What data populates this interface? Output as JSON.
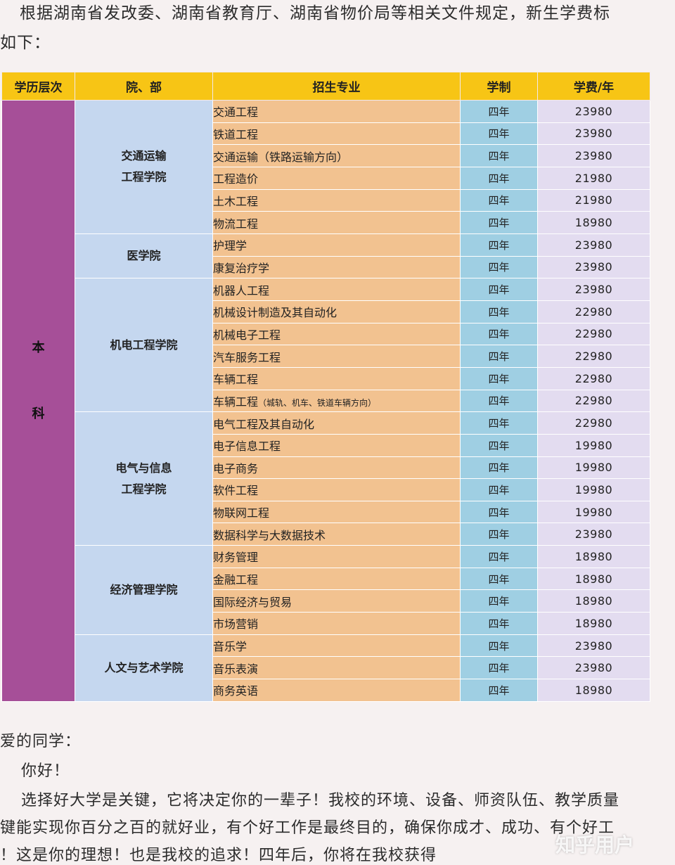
{
  "intro": {
    "line1": "根据湖南省发改委、湖南省教育厅、湖南省物价局等相关文件规定，新生学费标",
    "line2": "如下："
  },
  "table": {
    "headers": [
      "学历层次",
      "院、部",
      "招生专业",
      "学制",
      "学费/年"
    ],
    "level_chars": [
      "本",
      "科"
    ],
    "departments": [
      {
        "name_lines": [
          "交通运输",
          "工程学院"
        ],
        "majors": [
          {
            "name": "交通工程",
            "years": "四年",
            "fee": "23980"
          },
          {
            "name": "铁道工程",
            "years": "四年",
            "fee": "23980"
          },
          {
            "name": "交通运输（铁路运输方向）",
            "years": "四年",
            "fee": "23980"
          },
          {
            "name": "工程造价",
            "years": "四年",
            "fee": "21980"
          },
          {
            "name": "土木工程",
            "years": "四年",
            "fee": "21980"
          },
          {
            "name": "物流工程",
            "years": "四年",
            "fee": "18980"
          }
        ]
      },
      {
        "name_lines": [
          "医学院"
        ],
        "majors": [
          {
            "name": "护理学",
            "years": "四年",
            "fee": "23980"
          },
          {
            "name": "康复治疗学",
            "years": "四年",
            "fee": "23980"
          }
        ]
      },
      {
        "name_lines": [
          "机电工程学院"
        ],
        "majors": [
          {
            "name": "机器人工程",
            "years": "四年",
            "fee": "23980"
          },
          {
            "name": "机械设计制造及其自动化",
            "years": "四年",
            "fee": "22980"
          },
          {
            "name": "机械电子工程",
            "years": "四年",
            "fee": "22980"
          },
          {
            "name": "汽车服务工程",
            "years": "四年",
            "fee": "22980"
          },
          {
            "name": "车辆工程",
            "years": "四年",
            "fee": "22980"
          },
          {
            "name": "车辆工程",
            "note": "（城轨、机车、铁道车辆方向）",
            "years": "四年",
            "fee": "22980"
          }
        ]
      },
      {
        "name_lines": [
          "电气与信息",
          "工程学院"
        ],
        "majors": [
          {
            "name": "电气工程及其自动化",
            "years": "四年",
            "fee": "22980"
          },
          {
            "name": "电子信息工程",
            "years": "四年",
            "fee": "19980"
          },
          {
            "name": "电子商务",
            "years": "四年",
            "fee": "19980"
          },
          {
            "name": "软件工程",
            "years": "四年",
            "fee": "19980"
          },
          {
            "name": "物联网工程",
            "years": "四年",
            "fee": "19980"
          },
          {
            "name": "数据科学与大数据技术",
            "years": "四年",
            "fee": "23980"
          }
        ]
      },
      {
        "name_lines": [
          "经济管理学院"
        ],
        "majors": [
          {
            "name": "财务管理",
            "years": "四年",
            "fee": "18980"
          },
          {
            "name": "金融工程",
            "years": "四年",
            "fee": "18980"
          },
          {
            "name": "国际经济与贸易",
            "years": "四年",
            "fee": "18980"
          },
          {
            "name": "市场营销",
            "years": "四年",
            "fee": "18980"
          }
        ]
      },
      {
        "name_lines": [
          "人文与艺术学院"
        ],
        "majors": [
          {
            "name": "音乐学",
            "years": "四年",
            "fee": "23980"
          },
          {
            "name": "音乐表演",
            "years": "四年",
            "fee": "23980"
          },
          {
            "name": "商务英语",
            "years": "四年",
            "fee": "18980"
          }
        ]
      }
    ]
  },
  "letter": {
    "greeting": "爱的同学：",
    "hello": "你好！",
    "p1": "选择好大学是关键，它将决定你的一辈子！我校的环境、设备、师资队伍、教学质量",
    "p2": "键能实现你百分之百的就好业，有个好工作是最终目的，确保你成才、成功、有个好工",
    "p3": "！这是你的理想！也是我校的追求！四年后，你将在我校获得"
  },
  "watermark": "知乎用户"
}
